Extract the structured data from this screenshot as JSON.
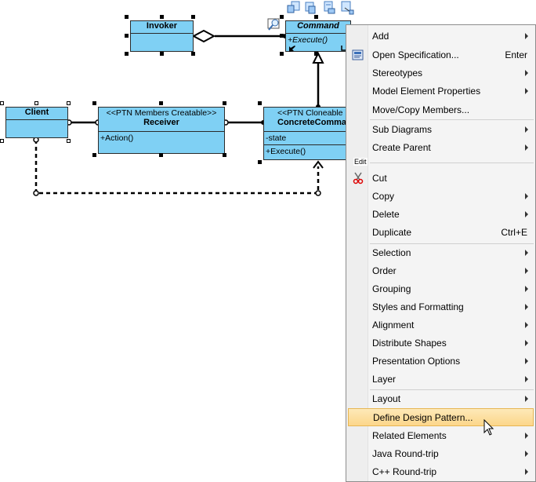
{
  "classes": {
    "invoker": {
      "name": "Invoker"
    },
    "command": {
      "name": "Command",
      "op": "+Execute()"
    },
    "client": {
      "name": "Client"
    },
    "receiver": {
      "stereotype": "<<PTN Members Creatable>>",
      "name": "Receiver",
      "op": "+Action()"
    },
    "concrete": {
      "stereotype": "<<PTN Cloneable",
      "name": "ConcreteComma",
      "attr": "-state",
      "op": "+Execute()"
    }
  },
  "menu": {
    "items": [
      {
        "label": "Add",
        "submenu": true
      },
      {
        "label": "Open Specification...",
        "shortcut": "Enter",
        "icon": "specification-icon"
      },
      {
        "label": "Stereotypes",
        "submenu": true
      },
      {
        "label": "Model Element Properties",
        "submenu": true
      },
      {
        "label": "Move/Copy Members..."
      },
      {
        "label": "Sub Diagrams",
        "submenu": true
      },
      {
        "label": "Create Parent",
        "submenu": true
      },
      {
        "label": "Cut",
        "icon": "scissors-icon"
      },
      {
        "label": "Copy",
        "submenu": true
      },
      {
        "label": "Delete",
        "submenu": true
      },
      {
        "label": "Duplicate",
        "shortcut": "Ctrl+E"
      },
      {
        "label": "Selection",
        "submenu": true
      },
      {
        "label": "Order",
        "submenu": true
      },
      {
        "label": "Grouping",
        "submenu": true
      },
      {
        "label": "Styles and Formatting",
        "submenu": true
      },
      {
        "label": "Alignment",
        "submenu": true
      },
      {
        "label": "Distribute Shapes",
        "submenu": true
      },
      {
        "label": "Presentation Options",
        "submenu": true
      },
      {
        "label": "Layer",
        "submenu": true
      },
      {
        "label": "Layout",
        "submenu": true
      },
      {
        "label": "Define Design Pattern...",
        "highlighted": true
      },
      {
        "label": "Related Elements",
        "submenu": true
      },
      {
        "label": "Java Round-trip",
        "submenu": true
      },
      {
        "label": "C++ Round-trip",
        "submenu": true
      }
    ],
    "edit_tag": "Edit"
  },
  "colors": {
    "class_fill": "#7fd0f4",
    "highlight": "#fcd68a",
    "menu_bg": "#f4f4f4"
  }
}
